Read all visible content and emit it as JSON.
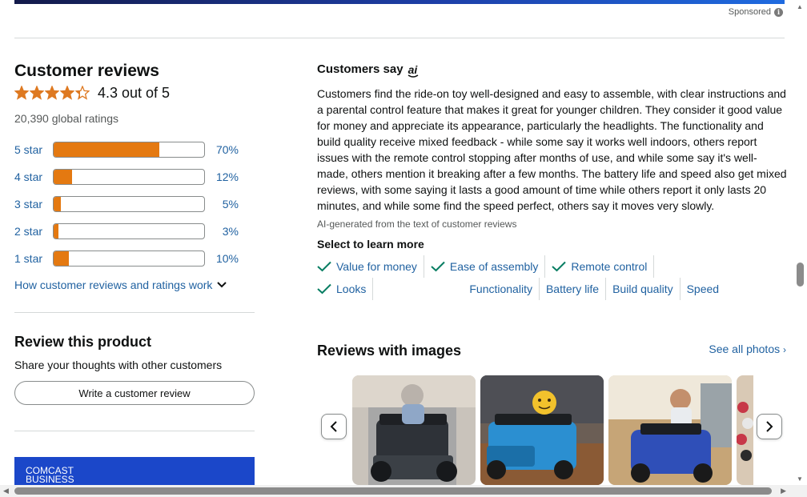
{
  "sponsored": {
    "label": "Sponsored"
  },
  "reviews": {
    "title": "Customer reviews",
    "rating_value": 4.3,
    "rating_text": "4.3 out of 5",
    "global_ratings": "20,390 global ratings",
    "histogram": [
      {
        "label": "5 star",
        "percent_text": "70%",
        "fraction": 0.7
      },
      {
        "label": "4 star",
        "percent_text": "12%",
        "fraction": 0.12
      },
      {
        "label": "3 star",
        "percent_text": "5%",
        "fraction": 0.05
      },
      {
        "label": "2 star",
        "percent_text": "3%",
        "fraction": 0.03
      },
      {
        "label": "1 star",
        "percent_text": "10%",
        "fraction": 0.1
      }
    ],
    "how_link": "How customer reviews and ratings work",
    "star_color": "#de7921"
  },
  "review_product": {
    "title": "Review this product",
    "subtitle": "Share your thoughts with other customers",
    "button_label": "Write a customer review"
  },
  "ad": {
    "text": "COMCAST\nBUSINESS"
  },
  "customers_say": {
    "title": "Customers say",
    "ai_badge": "ai",
    "summary": "Customers find the ride-on toy well-designed and easy to assemble, with clear instructions and a parental control feature that makes it great for younger children. They consider it good value for money and appreciate its appearance, particularly the headlights. The functionality and build quality receive mixed feedback - while some say it works well indoors, others report issues with the remote control stopping after months of use, and while some say it's well-made, others mention it breaking after a few months. The battery life and speed also get mixed reviews, with some saying it lasts a good amount of time while others report it only lasts 20 minutes, and while some find the speed perfect, others say it moves very slowly.",
    "ai_note": "AI-generated from the text of customer reviews",
    "learn_more": "Select to learn more",
    "aspects": [
      {
        "label": "Value for money",
        "positive": true
      },
      {
        "label": "Ease of assembly",
        "positive": true
      },
      {
        "label": "Remote control",
        "positive": true
      },
      {
        "label": "Looks",
        "positive": true
      },
      {
        "label": "Functionality",
        "positive": false
      },
      {
        "label": "Battery life",
        "positive": false
      },
      {
        "label": "Build quality",
        "positive": false
      },
      {
        "label": "Speed",
        "positive": false
      }
    ]
  },
  "reviews_with_images": {
    "title": "Reviews with images",
    "see_all": "See all photos"
  },
  "colors": {
    "link": "#2162a1",
    "bar_fill": "#e47911",
    "check": "#067d62"
  }
}
